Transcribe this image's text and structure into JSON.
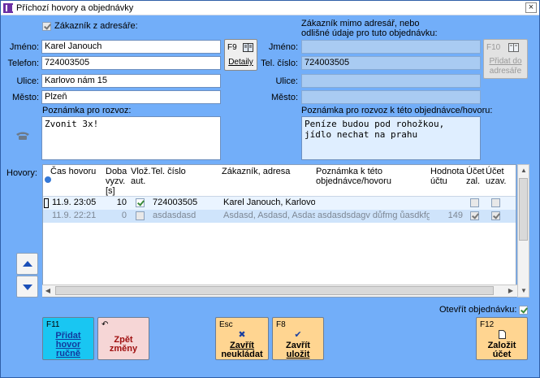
{
  "window": {
    "title": "Příchozí hovory a objednávky",
    "close_glyph": "×"
  },
  "left": {
    "from_address_book_label": "Zákazník z adresáře:",
    "from_address_book_checked": true,
    "name_label": "Jméno:",
    "name_value": "Karel Janouch",
    "phone_label": "Telefon:",
    "phone_value": "724003505",
    "street_label": "Ulice:",
    "street_value": "Karlovo nám 15",
    "city_label": "Město:",
    "city_value": "Plzeň",
    "note_label": "Poznámka pro rozvoz:",
    "note_value": "Zvonit 3x!",
    "details_key": "F9",
    "details_label": "Detaily"
  },
  "right": {
    "header_line1": "Zákazník mimo adresář, nebo",
    "header_line2": "odlišné údaje pro tuto objednávku:",
    "name_label": "Jméno:",
    "name_value": "",
    "phone_label": "Tel. číslo:",
    "phone_value": "724003505",
    "street_label": "Ulice:",
    "street_value": "",
    "city_label": "Město:",
    "city_value": "",
    "add_key": "F10",
    "add_label_line1": "Přidat do",
    "add_label_line2": "adresáře",
    "note_label": "Poznámka pro rozvoz k této objednávce/hovoru:",
    "note_value": "Peníze budou pod rohožkou,\njídlo nechat na prahu"
  },
  "calls": {
    "label": "Hovory:",
    "columns": [
      {
        "label": "Čas hovoru"
      },
      {
        "label": "Doba vyzv. [s]"
      },
      {
        "label": "Vlož. aut."
      },
      {
        "label": "Tel. číslo"
      },
      {
        "label": "Zákazník, adresa"
      },
      {
        "label": "Poznámka k této objednávce/hovoru"
      },
      {
        "label": "Hodnota účtu"
      },
      {
        "label": "Účet zal."
      },
      {
        "label": "Účet uzav."
      }
    ],
    "rows": [
      {
        "time": "11.9. 23:05",
        "duration": "10",
        "auto_inserted": true,
        "phone": "724003505",
        "customer": "Karel Janouch, Karlovo",
        "note": "",
        "value": "",
        "account_created": false,
        "account_closed": false,
        "current": true
      },
      {
        "time": "11.9. 22:21",
        "duration": "0",
        "auto_inserted": false,
        "phone": "asdasdasd",
        "customer": "Asdasd, Asdasd, Asdas",
        "note": "asdasdsdagv důfmg ůasdkfg",
        "value": "149",
        "account_created": true,
        "account_closed": true,
        "current": false
      }
    ]
  },
  "open_order_label": "Otevřít objednávku:",
  "open_order_checked": true,
  "buttons": {
    "add_call": {
      "key": "F11",
      "line1": "Přidat",
      "line2": "hovor",
      "line3": "ručně"
    },
    "undo": {
      "key": "↶",
      "line1": "Zpět",
      "line2": "změny"
    },
    "close_discard": {
      "key": "Esc",
      "icon": "✖",
      "line1": "Zavřít",
      "line2": "neukládat"
    },
    "close_save": {
      "key": "F8",
      "icon": "✔",
      "line1": "Zavřít",
      "line2": "uložit"
    },
    "create_account": {
      "key": "F12",
      "line1": "Založit",
      "line2": "účet"
    }
  },
  "colors": {
    "background": "#72AEF9",
    "cyan_button": "#19c6f2",
    "pink_button": "#f6d6d6",
    "yellow_button": "#ffd591",
    "disabled_field": "#a9cbf2"
  }
}
